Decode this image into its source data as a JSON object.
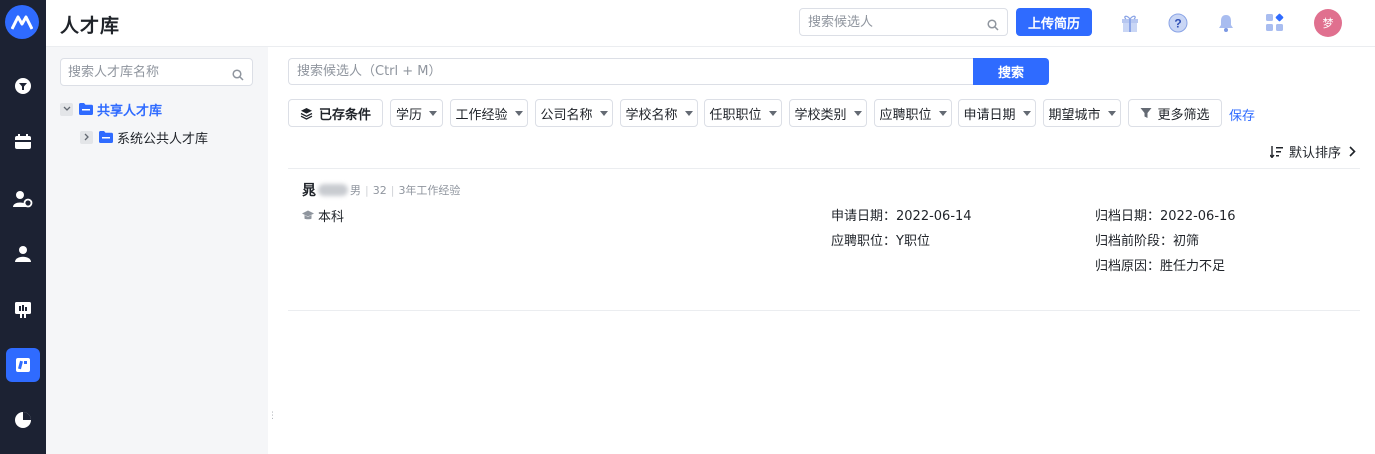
{
  "app": {
    "title": "人才库",
    "avatar_text": "梦",
    "upload_label": "上传简历",
    "top_search_placeholder": "搜索候选人"
  },
  "nav": {
    "items": [
      {
        "icon": "filter-funnel-icon"
      },
      {
        "icon": "calendar-icon"
      },
      {
        "icon": "user-settings-icon"
      },
      {
        "icon": "person-icon"
      },
      {
        "icon": "presentation-icon"
      },
      {
        "icon": "talent-pool-icon",
        "active": true
      },
      {
        "icon": "pie-chart-icon"
      }
    ]
  },
  "library": {
    "search_placeholder": "搜索人才库名称",
    "tree": [
      {
        "label": "共享人才库",
        "expanded": true,
        "children": [
          {
            "label": "系统公共人才库"
          }
        ]
      }
    ]
  },
  "search": {
    "placeholder": "搜索候选人（Ctrl + M）",
    "button": "搜索"
  },
  "filters": {
    "saved": "已存条件",
    "items": [
      "学历",
      "工作经验",
      "公司名称",
      "学校名称",
      "任职职位",
      "学校类别",
      "应聘职位",
      "申请日期",
      "期望城市"
    ],
    "more": "更多筛选",
    "save": "保存"
  },
  "sort": {
    "label": "默认排序"
  },
  "candidates": [
    {
      "name": "晁",
      "gender": "男",
      "age": "32",
      "experience": "3年工作经验",
      "education": "本科",
      "apply_date": "申请日期：2022-06-14",
      "apply_position": "应聘职位：Y职位",
      "archive_date": "归档日期：2022-06-16",
      "archive_stage": "归档前阶段：初筛",
      "archive_reason": "归档原因：胜任力不足"
    }
  ],
  "colors": {
    "accent": "#2f6bff",
    "rail": "#1c2233",
    "avatar": "#e0708f"
  }
}
